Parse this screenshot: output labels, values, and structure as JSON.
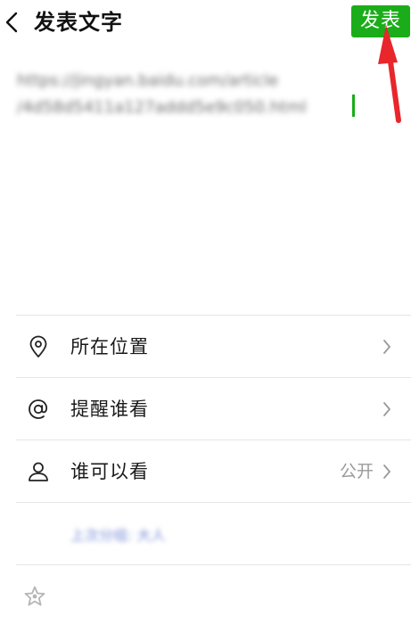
{
  "header": {
    "title": "发表文字",
    "publish_label": "发表",
    "publish_color": "#1aad19"
  },
  "post": {
    "text": "https://jingyan.baidu.com/article\n/4d58d5411a127addd5e9c050.html"
  },
  "options": [
    {
      "label": "所在位置",
      "icon": "location-pin-icon"
    },
    {
      "label": "提醒谁看",
      "icon": "at-sign-icon"
    },
    {
      "label": "谁可以看",
      "icon": "person-icon",
      "value": "公开"
    }
  ],
  "note": {
    "text": "上次分组: 大人"
  },
  "footer": {
    "icon": "star-icon"
  },
  "colors": {
    "accent_green": "#1aad19",
    "annotation_arrow": "#e8262b"
  }
}
